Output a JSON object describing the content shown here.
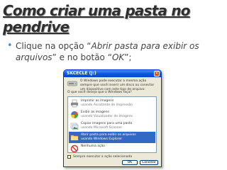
{
  "slide": {
    "title": "Como criar uma pasta no pendrive",
    "bullet": {
      "t1": "Clique na opção “",
      "t2": "Abrir pasta para exibir os arquivos",
      "t3": "” e no botão “",
      "t4": "OK",
      "t5": "”;"
    }
  },
  "dialog": {
    "title": "SKCECLE (J:)",
    "description": "O Windows pode executar a mesma ação sempre que você inserir um disco ou conectar um dispositivo com este tipo de arquivo:",
    "question": "O que você deseja que o Windows faça?",
    "options": [
      {
        "line1": "Imprimir as imagens",
        "line2": "usando Assistente de Impressão",
        "icon": "printer-icon"
      },
      {
        "line1": "Exibir as imagens",
        "line2": "usando Visualizador de Imagens",
        "icon": "image-viewer-icon"
      },
      {
        "line1": "Copiar imagens para uma pasta",
        "line2": "usando Microsoft Scanner",
        "icon": "copy-pictures-icon"
      },
      {
        "line1": "Abrir pasta para exibir os arquivos",
        "line2": "usando Windows Explorer",
        "icon": "folder-icon"
      },
      {
        "line1": "Nenhuma ação",
        "line2": "",
        "icon": "no-action-icon"
      }
    ],
    "checkbox_label": "Sempre executar a ação selecionada",
    "ok_label": "OK",
    "cancel_label": "Cancelar"
  },
  "colors": {
    "accent_bullet": "#4a8ec3",
    "xp_title_blue": "#0a5be0",
    "selection": "#316ac5"
  }
}
